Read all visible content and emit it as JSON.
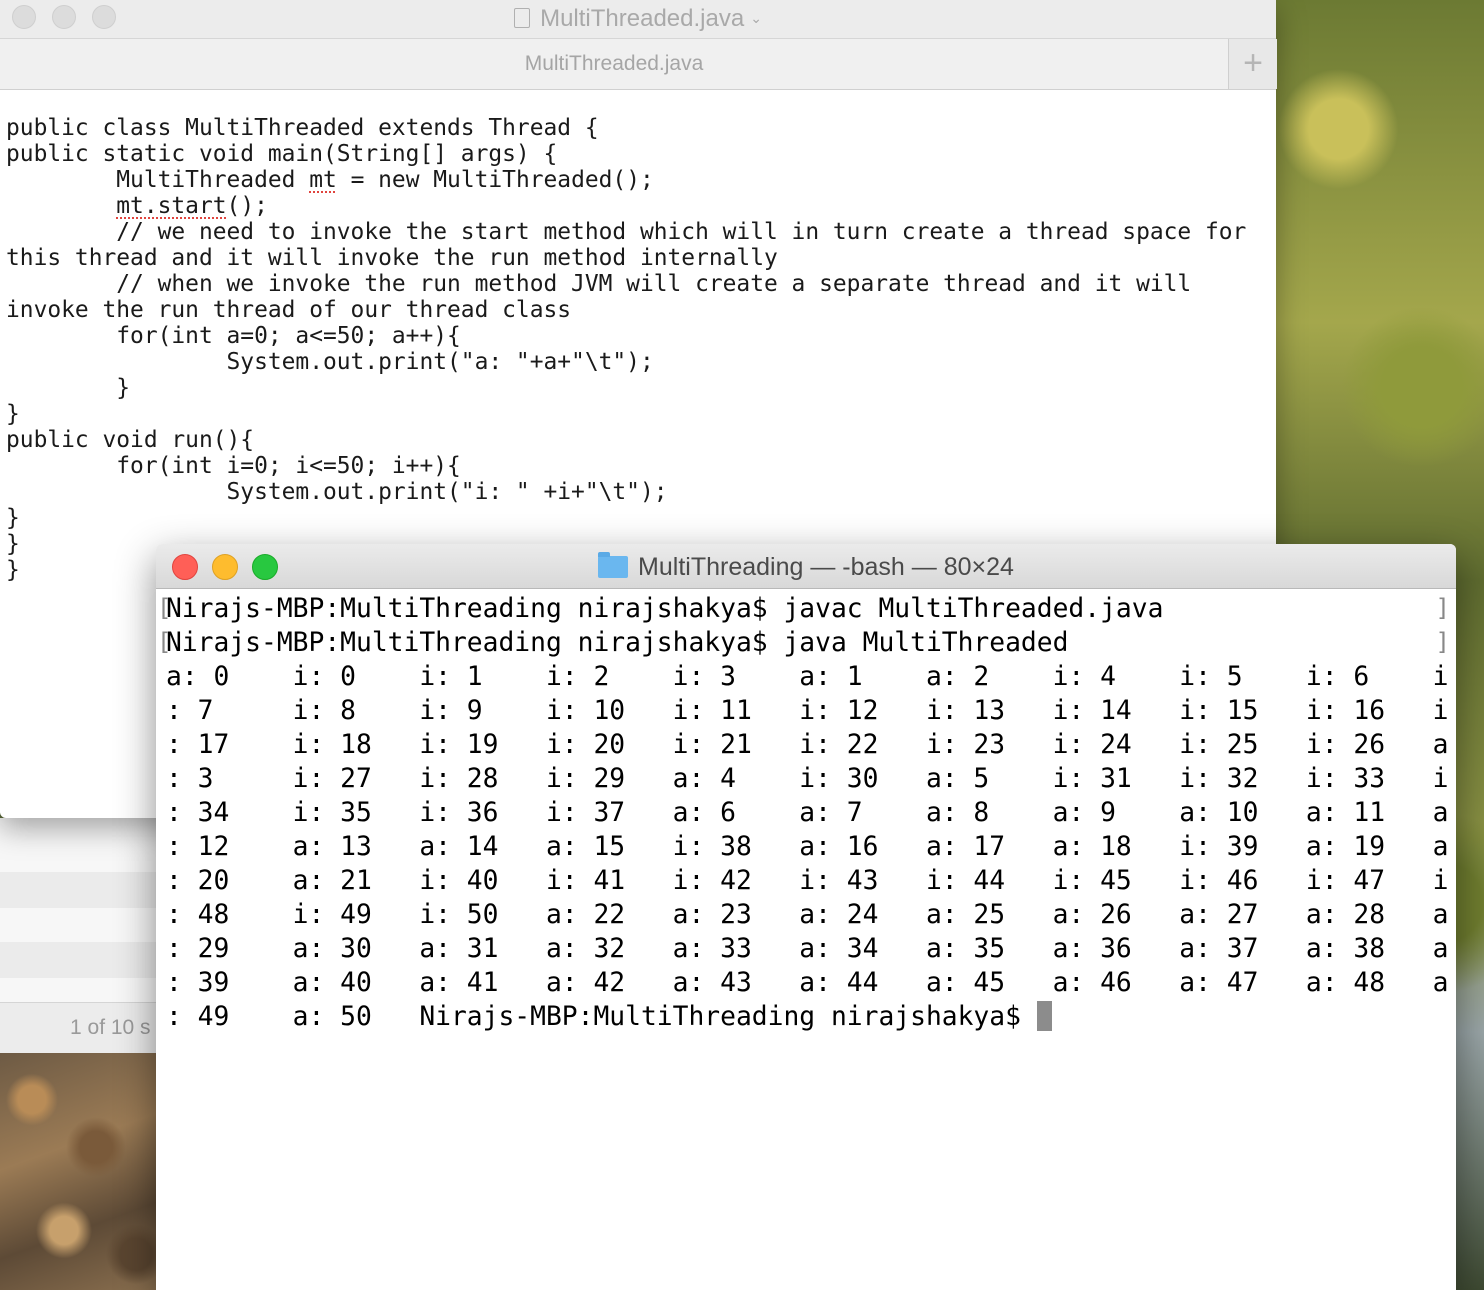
{
  "editor": {
    "window_title": "MultiThreaded.java",
    "tab_label": "MultiThreaded.java",
    "add_tab_symbol": "+",
    "code_lines": [
      "public class MultiThreaded extends Thread {",
      "public static void main(String[] args) {",
      "\tMultiThreaded mt = new MultiThreaded();",
      "\tmt.start();",
      "\t// we need to invoke the start method which will in turn create a thread space for",
      "this thread and it will invoke the run method internally",
      "\t// when we invoke the run method JVM will create a separate thread and it will",
      "invoke the run thread of our thread class",
      "\tfor(int a=0; a<=50; a++){",
      "\t\tSystem.out.print(\"a: \"+a+\"\\t\");",
      "\t}",
      "}",
      "public void run(){",
      "\tfor(int i=0; i<=50; i++){",
      "\t\tSystem.out.print(\"i: \" +i+\"\\t\");",
      "}",
      "}",
      "}"
    ]
  },
  "background_window": {
    "footer_text": "1 of 10 s"
  },
  "terminal": {
    "title": "MultiThreading — -bash — 80×24",
    "lines": [
      "Nirajs-MBP:MultiThreading nirajshakya$ javac MultiThreaded.java",
      "Nirajs-MBP:MultiThreading nirajshakya$ java MultiThreaded",
      "a: 0    i: 0    i: 1    i: 2    i: 3    a: 1    a: 2    i: 4    i: 5    i: 6    i",
      ": 7     i: 8    i: 9    i: 10   i: 11   i: 12   i: 13   i: 14   i: 15   i: 16   i",
      ": 17    i: 18   i: 19   i: 20   i: 21   i: 22   i: 23   i: 24   i: 25   i: 26   a",
      ": 3     i: 27   i: 28   i: 29   a: 4    i: 30   a: 5    i: 31   i: 32   i: 33   i",
      ": 34    i: 35   i: 36   i: 37   a: 6    a: 7    a: 8    a: 9    a: 10   a: 11   a",
      ": 12    a: 13   a: 14   a: 15   i: 38   a: 16   a: 17   a: 18   i: 39   a: 19   a",
      ": 20    a: 21   i: 40   i: 41   i: 42   i: 43   i: 44   i: 45   i: 46   i: 47   i",
      ": 48    i: 49   i: 50   a: 22   a: 23   a: 24   a: 25   a: 26   a: 27   a: 28   a",
      ": 29    a: 30   a: 31   a: 32   a: 33   a: 34   a: 35   a: 36   a: 37   a: 38   a",
      ": 39    a: 40   a: 41   a: 42   a: 43   a: 44   a: 45   a: 46   a: 47   a: 48   a",
      ": 49    a: 50   Nirajs-MBP:MultiThreading nirajshakya$ "
    ]
  }
}
